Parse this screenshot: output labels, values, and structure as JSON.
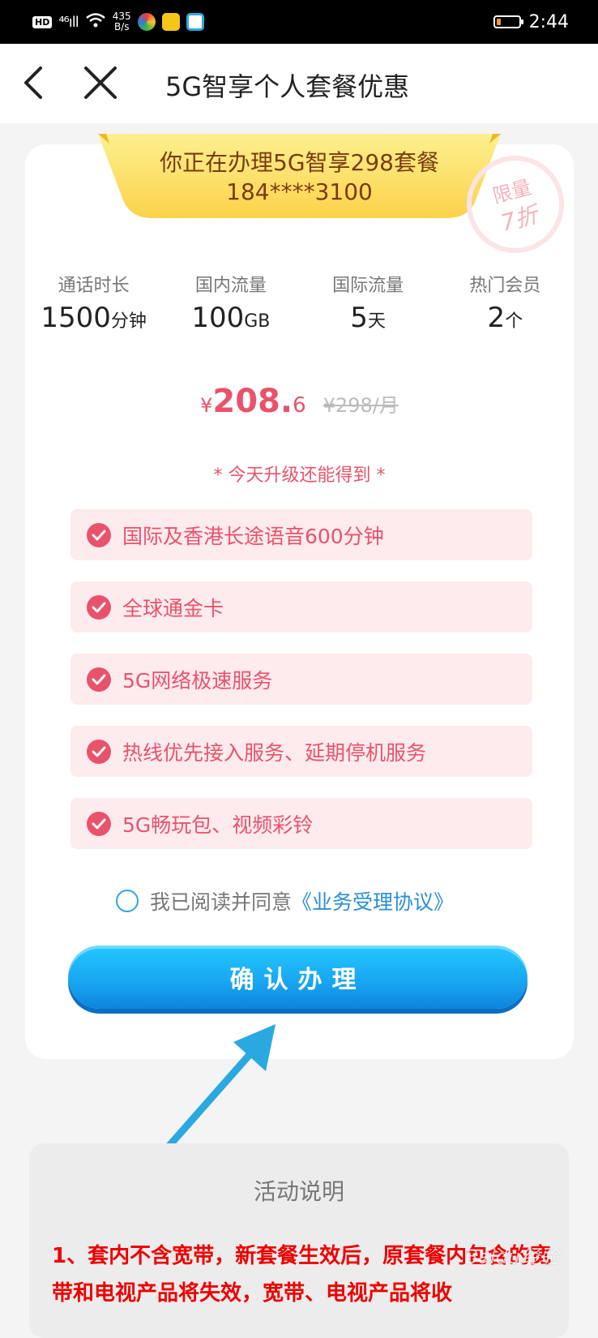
{
  "status_bar": {
    "hd": "HD",
    "signal": "⁴⁶ıll",
    "speed_value": "435",
    "speed_unit": "B/s",
    "time": "2:44"
  },
  "nav": {
    "title": "5G智享个人套餐优惠"
  },
  "banner": {
    "line1": "你正在办理5G智享298套餐",
    "line2": "184****3100"
  },
  "stamp": {
    "line1": "限量",
    "line2": "7折"
  },
  "stats": [
    {
      "label": "通话时长",
      "value": "1500",
      "unit": "分钟"
    },
    {
      "label": "国内流量",
      "value": "100",
      "unit": "GB"
    },
    {
      "label": "国际流量",
      "value": "5",
      "unit": "天"
    },
    {
      "label": "热门会员",
      "value": "2",
      "unit": "个"
    }
  ],
  "price": {
    "currency": "¥",
    "main": "208.",
    "decimal": "6",
    "original": "¥298/月"
  },
  "gift_title": "* 今天升级还能得到 *",
  "benefits": [
    "国际及香港长途语音600分钟",
    "全球通金卡",
    "5G网络极速服务",
    "热线优先接入服务、延期停机服务",
    "5G畅玩包、视频彩铃"
  ],
  "agreement": {
    "text": "我已阅读并同意",
    "link": "《业务受理协议》"
  },
  "confirm_label": "确认办理",
  "notice": {
    "title": "活动说明",
    "body": "1、套内不含宽带，新套餐生效后，原套餐内包含的宽带和电视产品将失效，宽带、电视产品将收"
  },
  "watermark": "Baidu经验",
  "colors": {
    "accent_pink": "#e8536b",
    "button_blue": "#18a4f0",
    "banner_yellow": "#fbe36a",
    "notice_red": "#ee0000",
    "arrow_blue": "#2aa9e0"
  }
}
